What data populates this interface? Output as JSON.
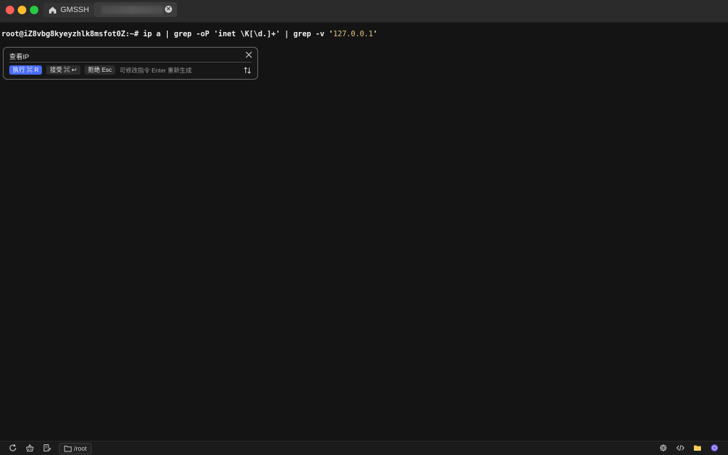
{
  "tabs": {
    "home_label": "GMSSH",
    "session_close": "✕"
  },
  "terminal": {
    "prompt": "root@iZ8vbg8kyeyzhlk8msfot0Z:~# ",
    "command_prefix": "ip a | grep -oP 'inet \\K[\\d.]+' | grep -v '",
    "command_ip": "127.0.0.1",
    "command_suffix": "'"
  },
  "ai_panel": {
    "prompt": "查看IP",
    "execute_label": "执行 ⌘ R",
    "accept_label": "接受 ⌘ ↩",
    "reject_label": "拒绝 Esc",
    "hint": "可修改指令 Enter 重新生成"
  },
  "statusbar": {
    "path": "/root"
  },
  "colors": {
    "accent": "#4a6cf7",
    "string": "#e5c07b",
    "background": "#141414"
  },
  "icons": [
    "home-icon",
    "close-icon",
    "sort-icon",
    "refresh-icon",
    "basket-icon",
    "edit-file-icon",
    "folder-icon",
    "gear-icon",
    "code-icon",
    "yellow-folder-icon",
    "app-logo-icon"
  ]
}
